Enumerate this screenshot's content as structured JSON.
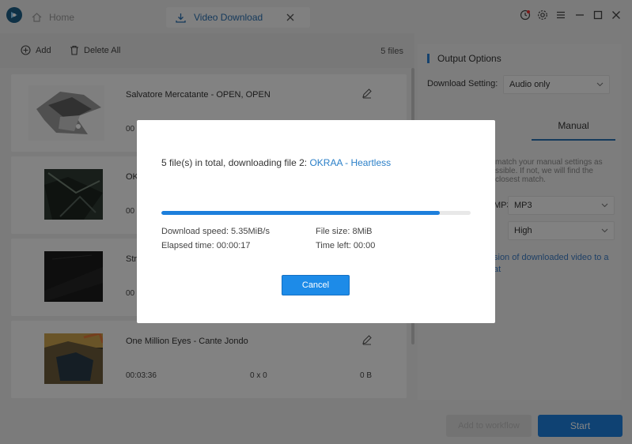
{
  "titlebar": {
    "home_tab": "Home",
    "active_tab": "Video Download"
  },
  "toolbar": {
    "add_label": "Add",
    "delete_all_label": "Delete All",
    "file_count": "5 files"
  },
  "list": {
    "items": [
      {
        "title": "Salvatore Mercatante - OPEN, OPEN",
        "duration": "00",
        "resolution": "",
        "size": ""
      },
      {
        "title": "OK",
        "duration": "00",
        "resolution": "",
        "size": ""
      },
      {
        "title": "Str",
        "duration": "00",
        "resolution": "",
        "size": ""
      },
      {
        "title": "One Million Eyes - Cante Jondo",
        "duration": "00:03:36",
        "resolution": "0 x 0",
        "size": "0 B"
      }
    ]
  },
  "panel": {
    "title": "Output Options",
    "download_setting_label": "Download Setting:",
    "download_setting_value": "Audio only",
    "manual_tab": "Manual",
    "note_line1": "match your manual settings as",
    "note_line2": "ssible. If not, we will find the",
    "note_line3": "closest match.",
    "format_label": "at:",
    "format_value": "MP3",
    "quality_label": "le:",
    "quality_value": "High",
    "link_line1": "sion of downloaded video to a",
    "link_line2": "at"
  },
  "footer": {
    "workflow_label": "Add to workflow",
    "start_label": "Start"
  },
  "dialog": {
    "status_prefix": "5 file(s) in total, downloading file 2: ",
    "current_file": "OKRAA - Heartless",
    "progress": 0.9,
    "download_speed": "Download speed: 5.35MiB/s",
    "file_size": "File size: 8MiB",
    "elapsed_time": "Elapsed time: 00:00:17",
    "time_left": "Time left: 00:00",
    "cancel_label": "Cancel"
  },
  "colors": {
    "accent": "#1d7fdc",
    "link": "#2a7fc8"
  }
}
